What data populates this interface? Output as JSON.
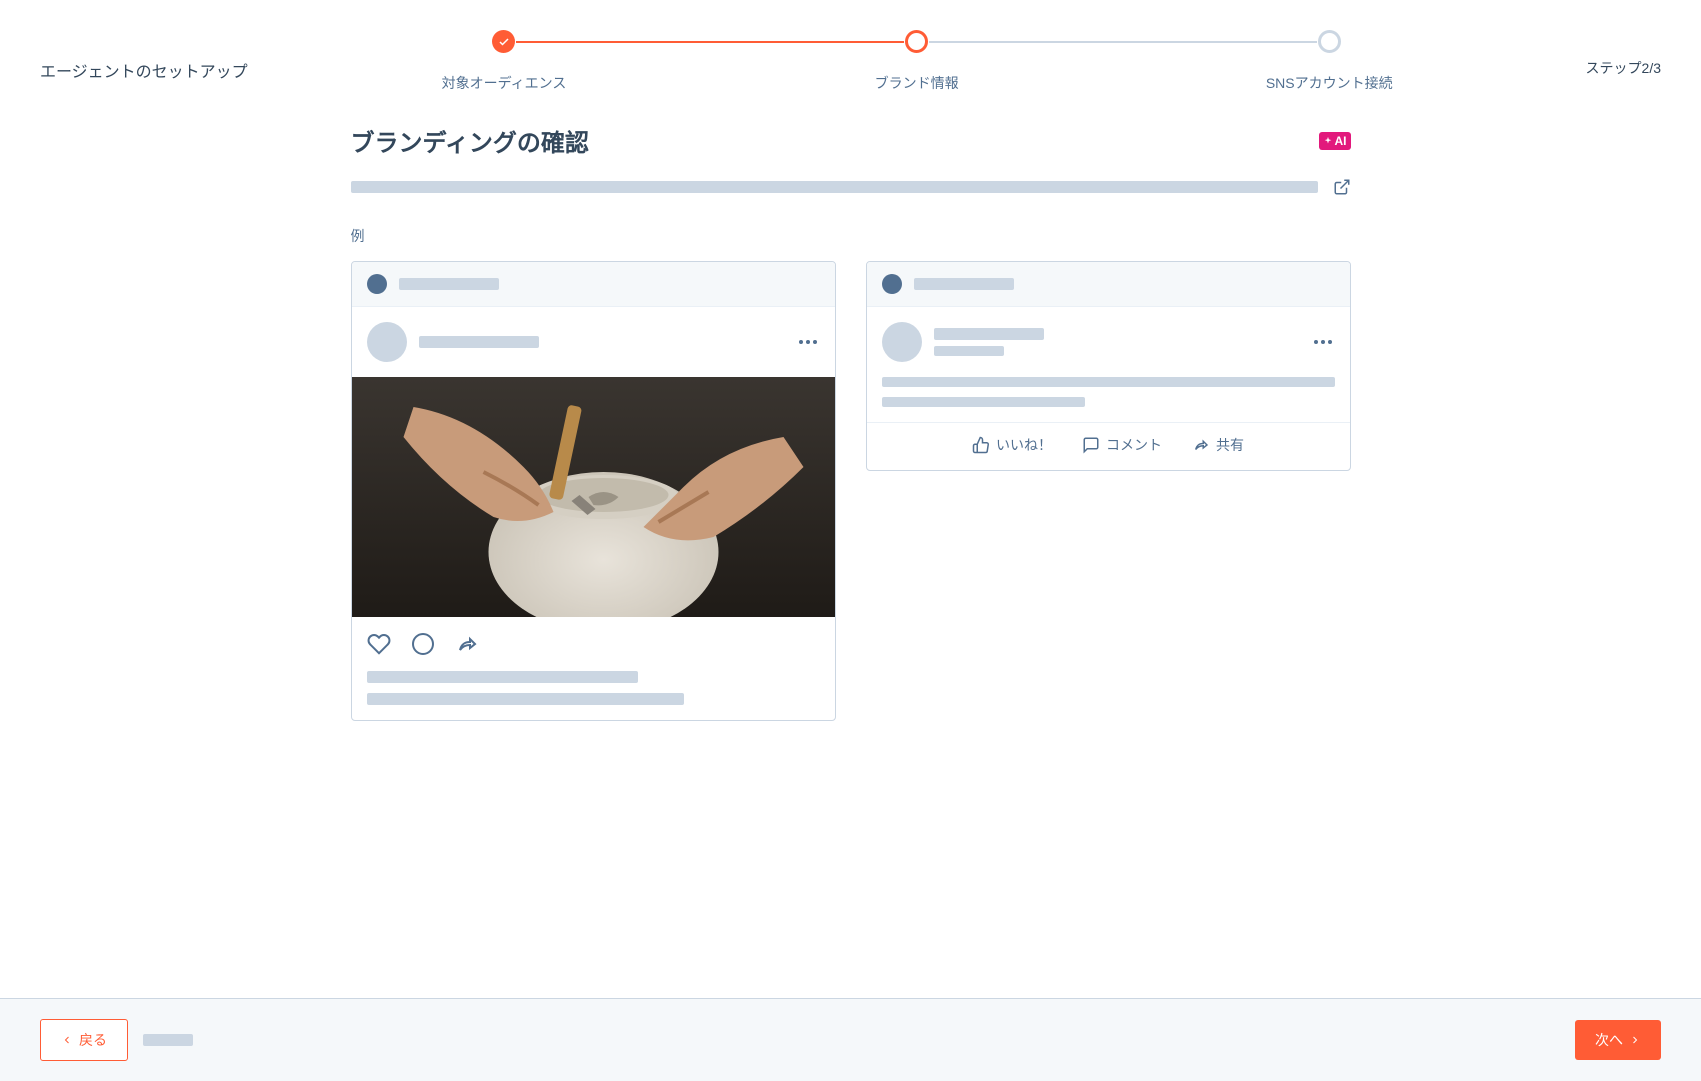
{
  "header": {
    "title": "エージェントのセットアップ",
    "step_count": "ステップ2/3",
    "steps": [
      {
        "label": "対象オーディエンス",
        "state": "completed"
      },
      {
        "label": "ブランド情報",
        "state": "active"
      },
      {
        "label": "SNSアカウント接続",
        "state": "pending"
      }
    ]
  },
  "main": {
    "section_title": "ブランディングの確認",
    "ai_badge": "AI",
    "example_label": "例",
    "instagram_card": {
      "actions": [
        "heart",
        "comment-circle",
        "share"
      ]
    },
    "linkedin_card": {
      "actions": {
        "like": "いいね！",
        "comment": "コメント",
        "share": "共有"
      }
    }
  },
  "footer": {
    "back": "戻る",
    "next": "次へ"
  }
}
